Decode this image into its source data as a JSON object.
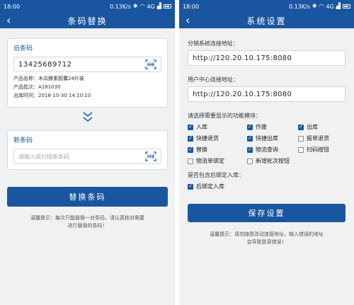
{
  "colors": {
    "primary": "#1a56a0",
    "background": "#f0f1f3"
  },
  "left": {
    "status": {
      "time": "18:00",
      "right_text": "0.13K/s",
      "network": "4G"
    },
    "title": "条码替换",
    "old_barcode": {
      "label": "旧条码",
      "value": "13425689712",
      "product_name": "产品名称：木瓜酵素胶囊24片装",
      "product_batch": "产品批次：A181030",
      "ship_time": "出库时间：2018-10-30 14:10:10"
    },
    "new_barcode": {
      "label": "新条码",
      "placeholder": "请输入或扫描新条码"
    },
    "replace_button": "替换条码",
    "tip_line1": "温馨提示：每次只能替换一对条码，请认真核对需要",
    "tip_line2": "进行替换的条码！"
  },
  "right": {
    "status": {
      "time": "18:00",
      "right_text": "0.13K/s",
      "network": "4G"
    },
    "title": "系统设置",
    "proxy_label": "分销系统连接地址：",
    "proxy_url": "http://120.20.10.175:8080",
    "user_label": "用户中心连接地址：",
    "user_url": "http://120.20.10.175:8080",
    "modules_label": "请选择需要显示的功能模块：",
    "modules": [
      {
        "label": "入库",
        "checked": true
      },
      {
        "label": "作废",
        "checked": true
      },
      {
        "label": "出库",
        "checked": true
      },
      {
        "label": "快捷退货",
        "checked": true
      },
      {
        "label": "快捷出库",
        "checked": true
      },
      {
        "label": "报单退货",
        "checked": false
      },
      {
        "label": "替换",
        "checked": true
      },
      {
        "label": "物流查询",
        "checked": true
      },
      {
        "label": "扫码按钮",
        "checked": false
      },
      {
        "label": "物流单绑定",
        "checked": false
      },
      {
        "label": "新增批次按钮",
        "checked": false
      }
    ],
    "post_storage_label": "是否包含后绑定入库：",
    "post_storage": {
      "label": "后绑定入库",
      "checked": true
    },
    "save_button": "保存设置",
    "tip_line1": "温馨提示：请勿随意改动连接地址，输入错误的地址",
    "tip_line2": "会导致登录错误！"
  }
}
